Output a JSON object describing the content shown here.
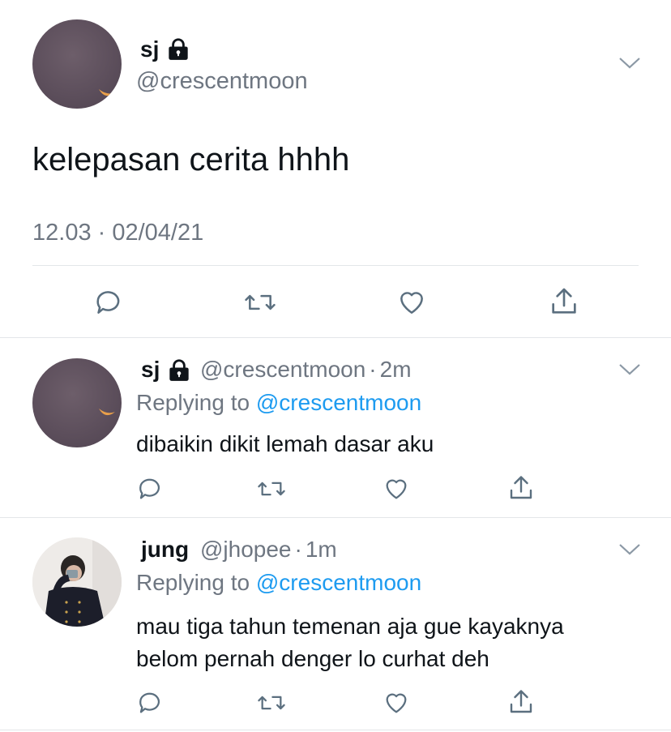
{
  "main_tweet": {
    "display_name": "sj",
    "handle": "@crescentmoon",
    "text": "kelepasan cerita hhhh",
    "timestamp": "12.03 · 02/04/21",
    "actions": [
      "reply-icon",
      "retweet-icon",
      "like-icon",
      "share-icon"
    ]
  },
  "replies": [
    {
      "display_name": "sj",
      "handle": "@crescentmoon",
      "dot": "·",
      "time": "2m",
      "replying_prefix": "Replying to",
      "replying_handle": "@crescentmoon",
      "text_lines": [
        "dibaikin dikit lemah dasar aku"
      ],
      "locked": true
    },
    {
      "display_name": "jung",
      "handle": "@jhopee",
      "dot": "·",
      "time": "1m",
      "replying_prefix": "Replying to",
      "replying_handle": "@crescentmoon",
      "text_lines": [
        "mau tiga tahun temenan aja gue kayaknya",
        "belom pernah denger lo curhat deh"
      ],
      "locked": false
    }
  ],
  "colors": {
    "link": "#1d9bf0",
    "muted": "#6e7681",
    "divider": "#e3e6e9"
  }
}
